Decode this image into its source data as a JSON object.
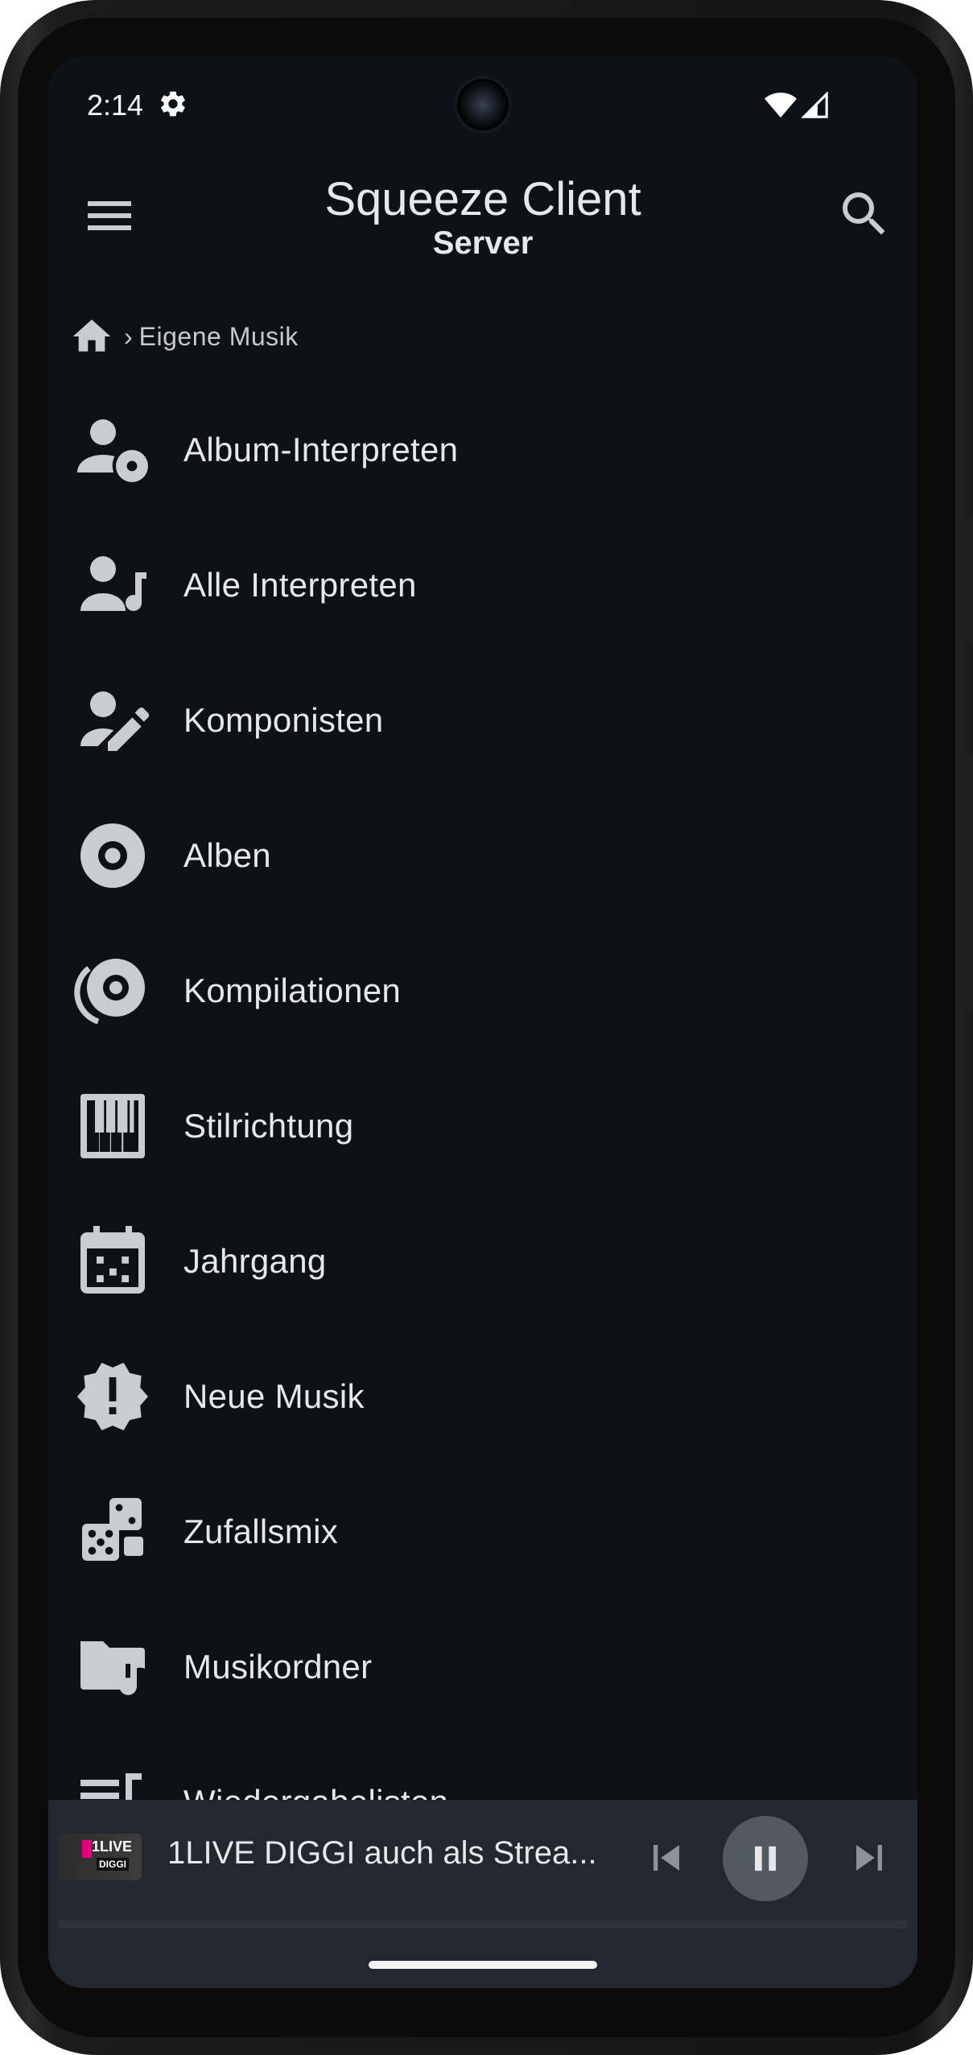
{
  "status_bar": {
    "time": "2:14"
  },
  "app_bar": {
    "title": "Squeeze Client",
    "subtitle": "Server"
  },
  "breadcrumb": {
    "separator": "›",
    "current": "Eigene Musik"
  },
  "menu_items": [
    {
      "label": "Album-Interpreten",
      "icon": "album-artist-icon"
    },
    {
      "label": "Alle Interpreten",
      "icon": "all-artists-icon"
    },
    {
      "label": "Komponisten",
      "icon": "composer-icon"
    },
    {
      "label": "Alben",
      "icon": "album-disc-icon"
    },
    {
      "label": "Kompilationen",
      "icon": "compilation-icon"
    },
    {
      "label": "Stilrichtung",
      "icon": "piano-icon"
    },
    {
      "label": "Jahrgang",
      "icon": "calendar-icon"
    },
    {
      "label": "Neue Musik",
      "icon": "new-alert-icon"
    },
    {
      "label": "Zufallsmix",
      "icon": "dice-icon"
    },
    {
      "label": "Musikordner",
      "icon": "music-folder-icon"
    },
    {
      "label": "Wiedergabelisten",
      "icon": "playlist-icon"
    }
  ],
  "now_playing": {
    "title": "1LIVE DIGGI auch als Strea...",
    "art_text": "1LIVE",
    "art_subtext": "DIGGI",
    "progress": 0
  },
  "colors": {
    "background": "#0e1217",
    "text": "#e6e8eb",
    "icon": "#c9cdd3",
    "now_playing_bar": "#232830",
    "pause_button": "#535961"
  }
}
